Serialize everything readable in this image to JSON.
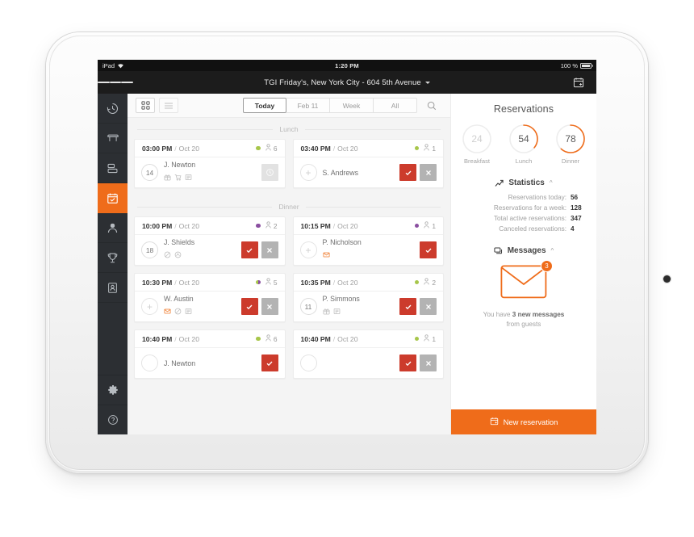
{
  "device": {
    "status_bar": {
      "carrier": "iPad",
      "wifi_icon": "wifi-icon",
      "time": "1:20 PM",
      "battery_pct": "100 %"
    }
  },
  "topbar": {
    "menu_icon": "hamburger-icon",
    "venue": "TGI Friday's, New York City - 604 5th Avenue",
    "caret_icon": "chevron-down-icon",
    "right_icon": "calendar-add-icon"
  },
  "sidebar": {
    "items": [
      {
        "name": "history",
        "icon": "clock-history-icon",
        "active": false
      },
      {
        "name": "tables",
        "icon": "table-icon",
        "active": false
      },
      {
        "name": "floorplan",
        "icon": "layout-icon",
        "active": false
      },
      {
        "name": "reservations",
        "icon": "calendar-check-icon",
        "active": true
      },
      {
        "name": "guests",
        "icon": "person-icon",
        "active": false
      },
      {
        "name": "rewards",
        "icon": "trophy-icon",
        "active": false
      },
      {
        "name": "contacts",
        "icon": "contact-book-icon",
        "active": false
      }
    ],
    "bottom_items": [
      {
        "name": "settings",
        "icon": "gear-icon"
      },
      {
        "name": "help",
        "icon": "question-circle-icon"
      }
    ]
  },
  "toolbar": {
    "view_grid_icon": "grid-view-icon",
    "view_list_icon": "list-view-icon",
    "filters": [
      {
        "label": "Today",
        "active": true
      },
      {
        "label": "Feb 11",
        "active": false
      },
      {
        "label": "Week",
        "active": false
      },
      {
        "label": "All",
        "active": false
      }
    ],
    "search_icon": "search-icon"
  },
  "sections": [
    {
      "title": "Lunch",
      "rows": [
        [
          {
            "time": "03:00 PM",
            "separator": "/",
            "date": "Oct 20",
            "dot": "green",
            "guests_icon": "guest-icon",
            "guests": "6",
            "table": "14",
            "guest_name": "J. Newton",
            "tags": [
              "gift-icon",
              "cart-icon",
              "note-icon"
            ],
            "tags_orange": [],
            "actions": [
              "clock"
            ]
          },
          {
            "time": "03:40 PM",
            "separator": "/",
            "date": "Oct 20",
            "dot": "green",
            "guests_icon": "guest-icon",
            "guests": "1",
            "table": "+",
            "guest_name": "S. Andrews",
            "tags": [],
            "tags_orange": [],
            "actions": [
              "confirm",
              "reject"
            ]
          }
        ]
      ]
    },
    {
      "title": "Dinner",
      "rows": [
        [
          {
            "time": "10:00 PM",
            "separator": "/",
            "date": "Oct 20",
            "dot": "purple",
            "guests_icon": "guest-icon",
            "guests": "2",
            "table": "18",
            "guest_name": "J. Shields",
            "tags": [
              "no-entry-icon",
              "allergy-icon"
            ],
            "tags_orange": [],
            "actions": [
              "confirm",
              "reject"
            ]
          },
          {
            "time": "10:15 PM",
            "separator": "/",
            "date": "Oct 20",
            "dot": "purple",
            "guests_icon": "guest-icon",
            "guests": "1",
            "table": "+",
            "guest_name": "P. Nicholson",
            "tags": [
              "envelope-icon"
            ],
            "tags_orange": [
              "envelope-icon"
            ],
            "actions": [
              "confirm"
            ]
          }
        ],
        [
          {
            "time": "10:30 PM",
            "separator": "/",
            "date": "Oct 20",
            "dot": "split",
            "guests_icon": "guest-icon",
            "guests": "5",
            "table": "+",
            "guest_name": "W. Austin",
            "tags": [
              "envelope-icon",
              "no-entry-icon",
              "note-icon"
            ],
            "tags_orange": [
              "envelope-icon"
            ],
            "actions": [
              "confirm",
              "reject"
            ]
          },
          {
            "time": "10:35 PM",
            "separator": "/",
            "date": "Oct 20",
            "dot": "green",
            "guests_icon": "guest-icon",
            "guests": "2",
            "table": "11",
            "guest_name": "P. Simmons",
            "tags": [
              "gift-icon",
              "note-icon"
            ],
            "tags_orange": [],
            "actions": [
              "confirm",
              "reject"
            ]
          }
        ],
        [
          {
            "time": "10:40 PM",
            "separator": "/",
            "date": "Oct 20",
            "dot": "green",
            "guests_icon": "guest-icon",
            "guests": "6",
            "table": "",
            "guest_name": "J. Newton",
            "tags": [],
            "tags_orange": [],
            "actions": [
              "confirm"
            ]
          },
          {
            "time": "10:40 PM",
            "separator": "/",
            "date": "Oct 20",
            "dot": "green",
            "guests_icon": "guest-icon",
            "guests": "1",
            "table": "",
            "guest_name": "",
            "tags": [],
            "tags_orange": [],
            "actions": [
              "confirm",
              "reject"
            ]
          }
        ]
      ]
    }
  ],
  "panel": {
    "title": "Reservations",
    "rings": [
      {
        "label": "Breakfast",
        "value": "24",
        "pct": 0,
        "muted": true
      },
      {
        "label": "Lunch",
        "value": "54",
        "pct": 36,
        "muted": false
      },
      {
        "label": "Dinner",
        "value": "78",
        "pct": 62,
        "muted": false
      }
    ],
    "statistics": {
      "icon": "chart-line-icon",
      "title": "Statistics",
      "chevron": "chevron-up-icon",
      "lines": [
        {
          "label": "Reservations today:",
          "value": "56"
        },
        {
          "label": "Reservations for a week:",
          "value": "128"
        },
        {
          "label": "Total active reservations:",
          "value": "347"
        },
        {
          "label": "Canceled reservations:",
          "value": "4"
        }
      ]
    },
    "messages": {
      "icon": "messages-icon",
      "title": "Messages",
      "chevron": "chevron-up-icon",
      "envelope_icon": "envelope-icon",
      "badge": "3",
      "text_before": "You have ",
      "text_bold": "3 new messages",
      "text_after": "from guests"
    },
    "new_reservation": {
      "icon": "calendar-add-icon",
      "label": "New reservation"
    }
  },
  "colors": {
    "accent_orange": "#ef6c1a",
    "confirm_red": "#cc3b2c",
    "reject_gray": "#b3b3b3",
    "lunch_green": "#a7c64a",
    "dinner_purple": "#8a4fa0",
    "rail_dark": "#2c2f33"
  }
}
